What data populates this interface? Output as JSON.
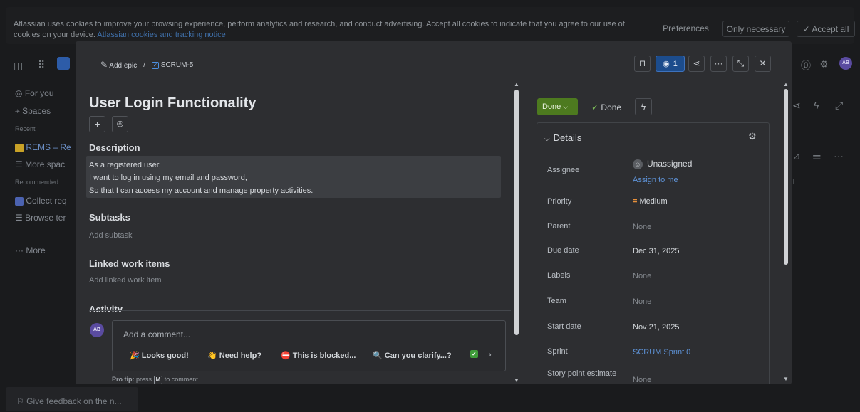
{
  "cookie_banner": {
    "text": "Atlassian uses cookies to improve your browsing experience, perform analytics and research, and conduct advertising. Accept all cookies to indicate that you agree to our use of cookies on your device.",
    "link": "Atlassian cookies and tracking notice",
    "preferences": "Preferences",
    "only_necessary": "Only necessary",
    "accept_all": "✓ Accept all"
  },
  "background": {
    "sidebar": {
      "for_you": "For you",
      "spaces": "Spaces",
      "recent": "Recent",
      "project": "REMS – Re",
      "more_spaces": "More spac",
      "recommended": "Recommended",
      "collect": "Collect req",
      "browse": "Browse ter",
      "more": "··· More"
    },
    "avatar_initials": "AB",
    "feedback": "Give feedback on the n..."
  },
  "modal": {
    "breadcrumb": {
      "add_epic": "Add epic",
      "separator": "/",
      "issue_key": "SCRUM-5"
    },
    "watchers_count": "1",
    "title": "User Login Functionality",
    "description": {
      "heading": "Description",
      "lines": [
        "As a registered user,",
        "I want to log in using my email and password,",
        "So that I can access my account and manage property activities."
      ]
    },
    "subtasks": {
      "heading": "Subtasks",
      "add": "Add subtask"
    },
    "linked": {
      "heading": "Linked work items",
      "add": "Add linked work item"
    },
    "activity": {
      "heading": "Activity",
      "avatar_initials": "AB",
      "comment_placeholder": "Add a comment...",
      "quick_replies": [
        "🎉 Looks good!",
        "👋 Need help?",
        "⛔ This is blocked...",
        "🔍 Can you clarify...?"
      ],
      "pro_tip_prefix": "Pro tip:",
      "pro_tip_mid": "press",
      "pro_tip_key": "M",
      "pro_tip_suffix": "to comment"
    },
    "status": {
      "button": "Done",
      "resolution": "Done"
    },
    "details": {
      "heading": "Details",
      "fields": {
        "assignee": {
          "label": "Assignee",
          "value": "Unassigned",
          "action": "Assign to me"
        },
        "priority": {
          "label": "Priority",
          "value": "Medium",
          "color": "#e8903a"
        },
        "parent": {
          "label": "Parent",
          "value": "None"
        },
        "due_date": {
          "label": "Due date",
          "value": "Dec 31, 2025"
        },
        "labels": {
          "label": "Labels",
          "value": "None"
        },
        "team": {
          "label": "Team",
          "value": "None"
        },
        "start_date": {
          "label": "Start date",
          "value": "Nov 21, 2025"
        },
        "sprint": {
          "label": "Sprint",
          "value": "SCRUM Sprint 0"
        },
        "story_points": {
          "label": "Story point estimate",
          "value": "None"
        }
      }
    }
  }
}
